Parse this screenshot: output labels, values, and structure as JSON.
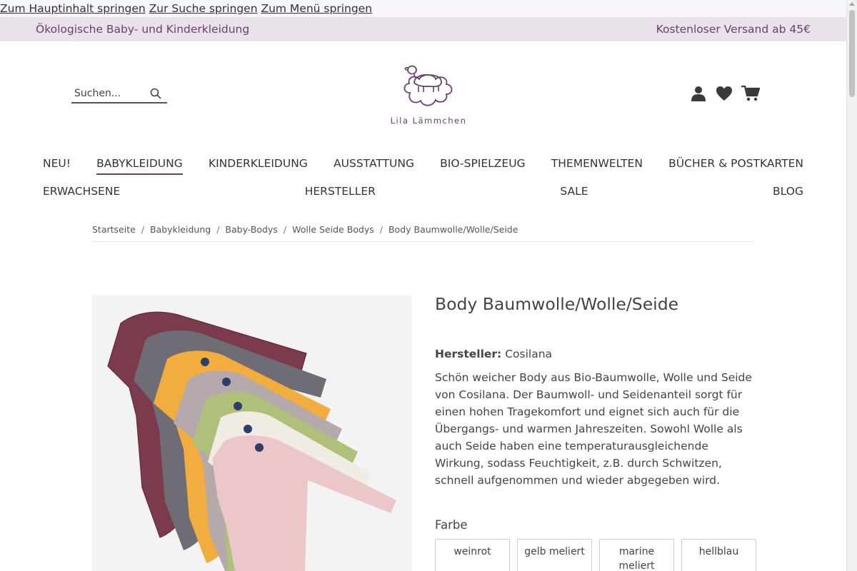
{
  "skip_links": [
    "Zum Hauptinhalt springen",
    "Zur Suche springen",
    "Zum Menü springen"
  ],
  "topbar": {
    "left_text": "Ökologische Baby- und Kinderkleidung",
    "right_text": "Kostenloser Versand ab 45€"
  },
  "search": {
    "placeholder": "Suchen..."
  },
  "logo": {
    "text": "Lila Lämmchen"
  },
  "header_icons": [
    "account-icon",
    "wishlist-heart-icon",
    "cart-icon"
  ],
  "nav": {
    "row1": [
      "NEU!",
      "BABYKLEIDUNG",
      "KINDERKLEIDUNG",
      "AUSSTATTUNG",
      "BIO-SPIELZEUG",
      "THEMENWELTEN",
      "BÜCHER & POSTKARTEN"
    ],
    "row2": [
      "ERWACHSENE",
      "HERSTELLER",
      "SALE",
      "BLOG"
    ],
    "active": "BABYKLEIDUNG"
  },
  "breadcrumb": [
    "Startseite",
    "Babykleidung",
    "Baby-Bodys",
    "Wolle Seide Bodys",
    "Body Baumwolle/Wolle/Seide"
  ],
  "breadcrumb_separator": "/",
  "product": {
    "title": "Body Baumwolle/Wolle/Seide",
    "manufacturer_label": "Hersteller:",
    "manufacturer": "Cosilana",
    "description": "Schön weicher Body aus Bio-Baumwolle, Wolle und Seide von Cosilana. Der Baumwoll- und Seidenanteil sorgt für einen hohen Tragekomfort und eignet sich auch für die Übergangs- und warmen Jahreszeiten. Sowohl Wolle als auch Seide haben eine temperaturausgleichende Wirkung, sodass Feuchtigkeit, z.B. durch Schwitzen, schnell aufgenommen und wieder abgegeben wird.",
    "color_label": "Farbe",
    "colors": [
      "weinrot",
      "gelb meliert",
      "marine meliert",
      "hellblau"
    ]
  },
  "colors": {
    "brand_purple": "#6b3f6e",
    "topbar_bg": "#e9e2ea"
  }
}
